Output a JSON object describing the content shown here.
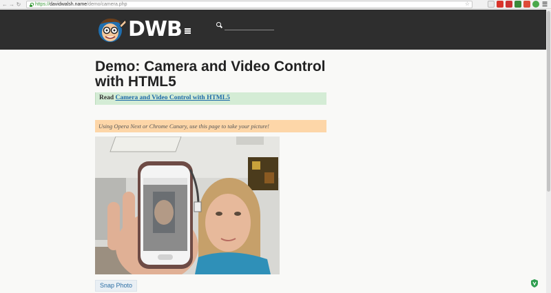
{
  "browser": {
    "url_scheme": "https://",
    "url_host": "davidwalsh.name",
    "url_path": "/demo/camera.php",
    "back_icon": "back-arrow-icon",
    "forward_icon": "forward-arrow-icon",
    "reload_icon": "reload-icon",
    "menu_icon": "hamburger-menu-icon"
  },
  "header": {
    "logo_text": "DWB",
    "search_placeholder": "",
    "bg_color": "#2e2e2e"
  },
  "page": {
    "title": "Demo: Camera and Video Control with HTML5",
    "read_prefix": "Read",
    "read_link": "Camera and Video Control with HTML5",
    "notice": "Using Opera Next or Chrome Canary, use this page to take your picture!",
    "snap_button": "Snap Photo"
  },
  "colors": {
    "read_box": "#d4ecd5",
    "notice_box": "#fdd6a8",
    "link": "#1c6aa8"
  }
}
